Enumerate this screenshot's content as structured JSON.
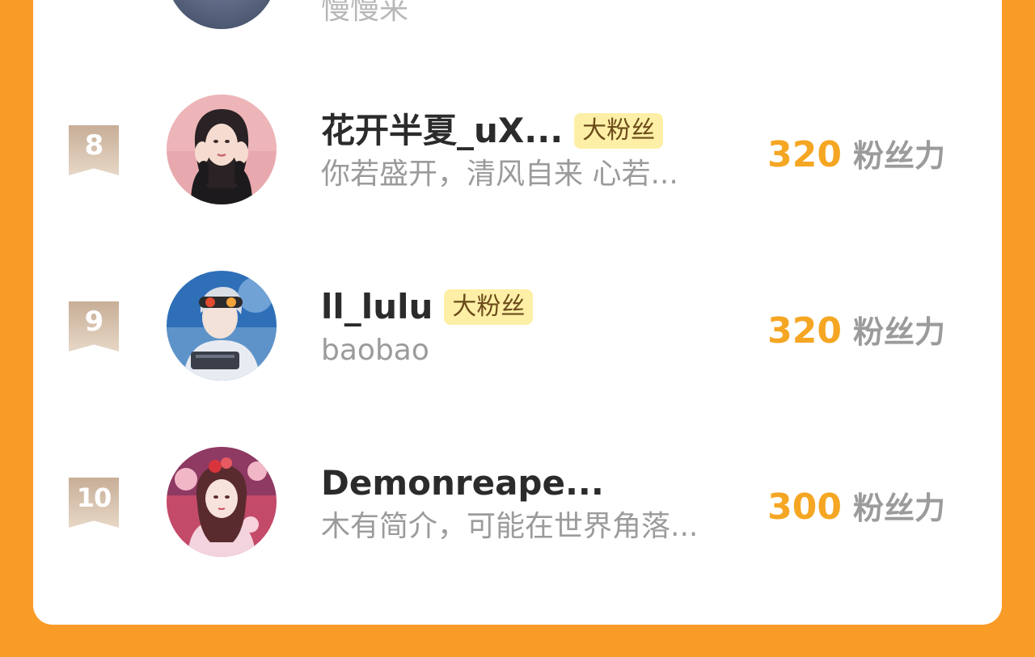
{
  "previous_item": {
    "bio": "慢慢来"
  },
  "leaderboard": [
    {
      "rank": "8",
      "name": "花开半夏_uX...",
      "tag": "大粉丝",
      "bio": "你若盛开，清风自来 心若...",
      "score": "320",
      "unit": "粉丝力",
      "avatar_icon": "avatar-woman-black-hair"
    },
    {
      "rank": "9",
      "name": "ll_lulu",
      "tag": "大粉丝",
      "bio": "baobao",
      "score": "320",
      "unit": "粉丝力",
      "avatar_icon": "avatar-anime-boy-goggles"
    },
    {
      "rank": "10",
      "name": "Demonreape...",
      "tag": "",
      "bio": "木有简介，可能在世界角落...",
      "score": "300",
      "unit": "粉丝力",
      "avatar_icon": "avatar-anime-girl-flowers"
    }
  ],
  "colors": {
    "background": "#F99B27",
    "score": "#F5A623",
    "tag_bg": "#FDEFA6",
    "muted_text": "#9b9b9b"
  }
}
